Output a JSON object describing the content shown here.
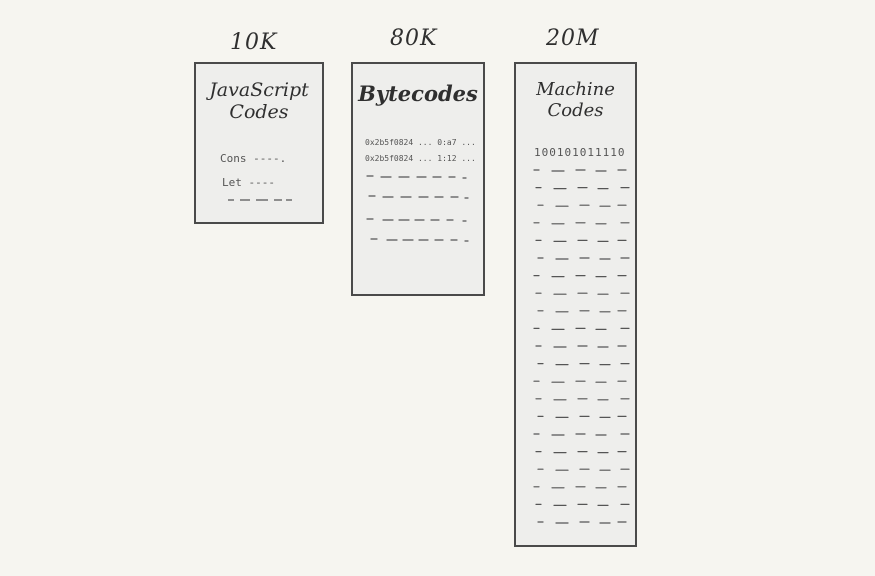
{
  "columns": [
    {
      "id": "js",
      "size_label": "10K",
      "title_lines": [
        "JavaScript",
        "Codes"
      ],
      "code_lines": [
        "Cons ----.",
        "Let ----"
      ]
    },
    {
      "id": "bytecode",
      "size_label": "80K",
      "title_lines": [
        "Bytecodes"
      ],
      "code_lines": [
        "0x2b5f0824 ... 0:a7 ...",
        "0x2b5f0824 ... 1:12 ..."
      ]
    },
    {
      "id": "machine",
      "size_label": "20M",
      "title_lines": [
        "Machine",
        "Codes"
      ],
      "code_lines": [
        "100101011110"
      ]
    }
  ],
  "colors": {
    "stroke": "#4a4a4a",
    "box_fill": "#eeeeec",
    "background": "#f6f5f0"
  }
}
